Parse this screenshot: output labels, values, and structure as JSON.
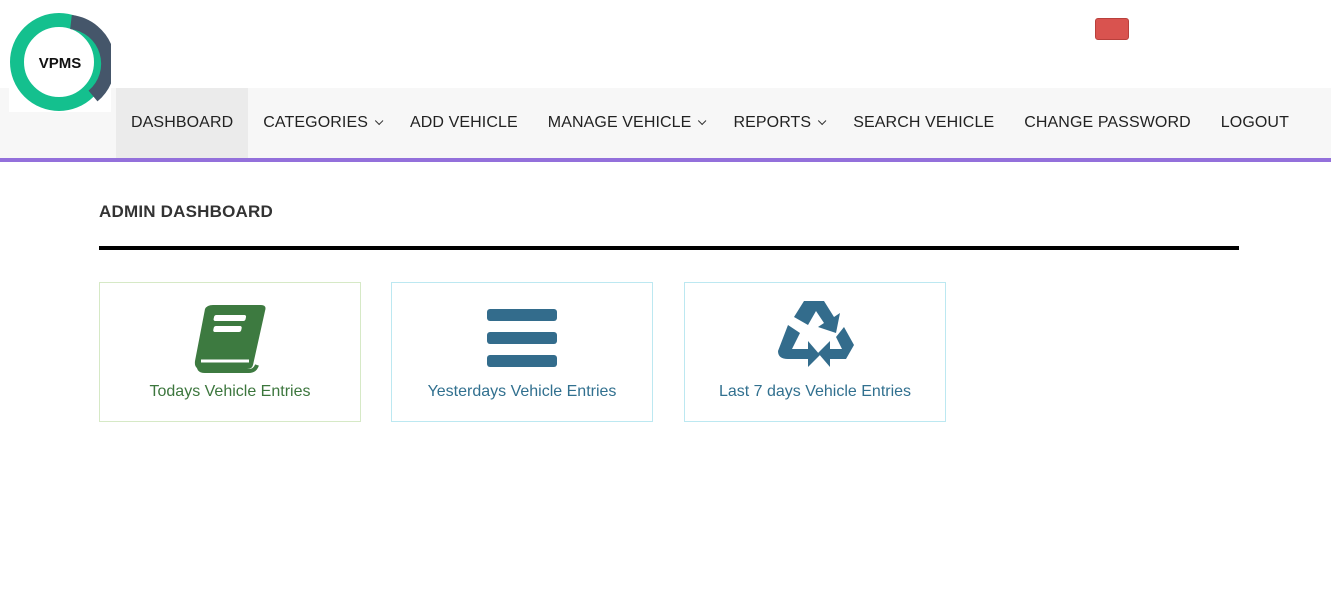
{
  "logo": {
    "text": "VPMS"
  },
  "nav": {
    "items": [
      {
        "label": "DASHBOARD",
        "active": true,
        "dropdown": false
      },
      {
        "label": "CATEGORIES",
        "dropdown": true
      },
      {
        "label": "ADD VEHICLE",
        "dropdown": false
      },
      {
        "label": "MANAGE VEHICLE",
        "dropdown": true
      },
      {
        "label": "REPORTS",
        "dropdown": true
      },
      {
        "label": "SEARCH VEHICLE",
        "dropdown": false
      },
      {
        "label": "CHANGE PASSWORD",
        "dropdown": false
      },
      {
        "label": "LOGOUT",
        "dropdown": false
      }
    ]
  },
  "page": {
    "title": "ADMIN DASHBOARD"
  },
  "cards": [
    {
      "label": "Todays Vehicle Entries",
      "icon": "book-icon"
    },
    {
      "label": "Yesterdays Vehicle Entries",
      "icon": "bars-icon"
    },
    {
      "label": "Last 7 days Vehicle Entries",
      "icon": "recycle-icon"
    }
  ],
  "colors": {
    "accent": "#9370db",
    "logo_green": "#14c08e",
    "logo_dark": "#45566a",
    "alert_red": "#d9534f",
    "success_green": "#3c763d",
    "info_blue": "#31708f",
    "icon_green": "#3d7a40",
    "icon_blue": "#336c8c"
  }
}
